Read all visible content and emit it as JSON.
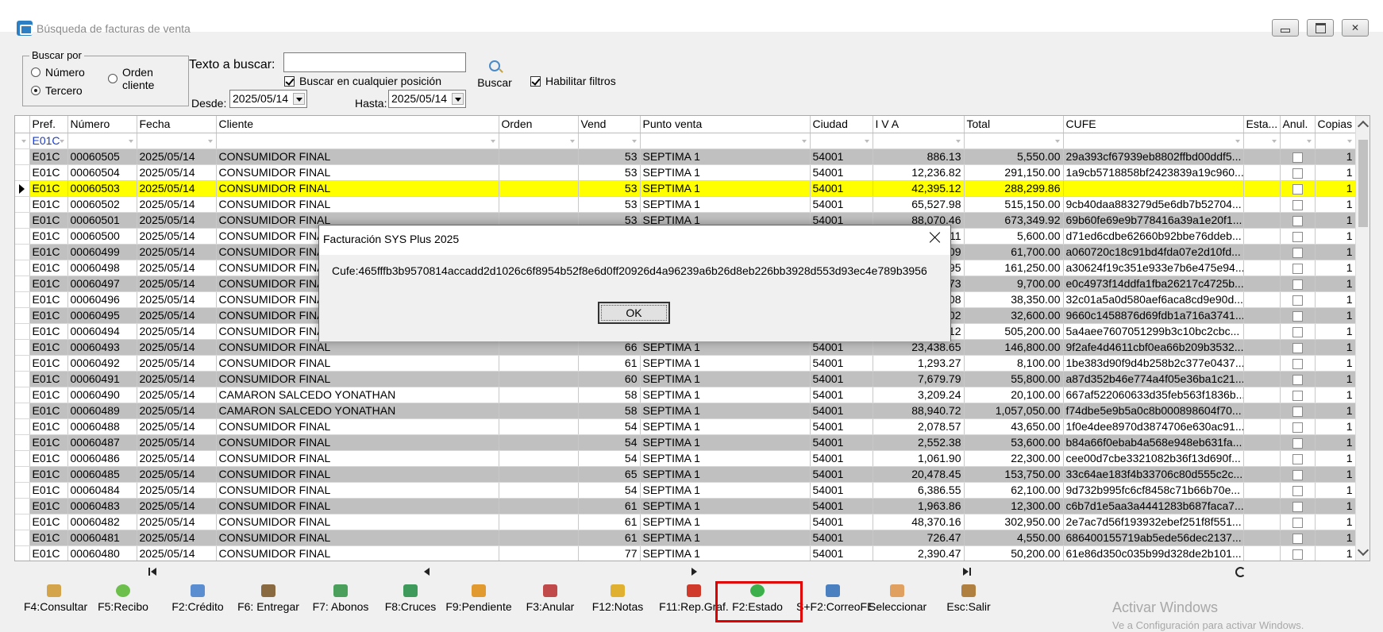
{
  "window": {
    "title": "Búsqueda de facturas de venta"
  },
  "search": {
    "group_label": "Buscar por",
    "radio_numero": "Número",
    "radio_orden": "Orden cliente",
    "radio_tercero": "Tercero",
    "selected": "Tercero",
    "text_label": "Texto a buscar:",
    "text_value": "",
    "any_position_label": "Buscar en cualquier posición",
    "any_position_checked": true,
    "filters_label": "Habilitar filtros",
    "filters_checked": true,
    "desde_label": "Desde:",
    "desde_value": "2025/05/14",
    "hasta_label": "Hasta:",
    "hasta_value": "2025/05/14",
    "buscar_label": "Buscar"
  },
  "grid": {
    "columns": [
      "Pref.",
      "Número",
      "Fecha",
      "Cliente",
      "Orden",
      "Vend",
      "Punto venta",
      "Ciudad",
      "I V A",
      "Total",
      "CUFE",
      "Esta...",
      "Anul.",
      "Copias"
    ],
    "filter_pref": "E01C",
    "selected_row_index": 2,
    "rows": [
      {
        "pref": "E01C",
        "numero": "00060505",
        "fecha": "2025/05/14",
        "cliente": "CONSUMIDOR FINAL",
        "orden": "",
        "vend": "53",
        "punto": "SEPTIMA 1",
        "ciudad": "54001",
        "iva": "886.13",
        "total": "5,550.00",
        "cufe": "29a393cf67939eb8802ffbd00ddf5...",
        "copias": "1"
      },
      {
        "pref": "E01C",
        "numero": "00060504",
        "fecha": "2025/05/14",
        "cliente": "CONSUMIDOR FINAL",
        "orden": "",
        "vend": "53",
        "punto": "SEPTIMA 1",
        "ciudad": "54001",
        "iva": "12,236.82",
        "total": "291,150.00",
        "cufe": "1a9cb5718858bf2423839a19c960...",
        "copias": "1"
      },
      {
        "pref": "E01C",
        "numero": "00060503",
        "fecha": "2025/05/14",
        "cliente": "CONSUMIDOR FINAL",
        "orden": "",
        "vend": "53",
        "punto": "SEPTIMA 1",
        "ciudad": "54001",
        "iva": "42,395.12",
        "total": "288,299.86",
        "cufe": "",
        "copias": "1"
      },
      {
        "pref": "E01C",
        "numero": "00060502",
        "fecha": "2025/05/14",
        "cliente": "CONSUMIDOR FINAL",
        "orden": "",
        "vend": "53",
        "punto": "SEPTIMA 1",
        "ciudad": "54001",
        "iva": "65,527.98",
        "total": "515,150.00",
        "cufe": "9cb40daa883279d5e6db7b52704...",
        "copias": "1"
      },
      {
        "pref": "E01C",
        "numero": "00060501",
        "fecha": "2025/05/14",
        "cliente": "CONSUMIDOR FINAL",
        "orden": "",
        "vend": "53",
        "punto": "SEPTIMA 1",
        "ciudad": "54001",
        "iva": "88,070.46",
        "total": "673,349.92",
        "cufe": "69b60fe69e9b778416a39a1e20f1...",
        "copias": "1"
      },
      {
        "pref": "E01C",
        "numero": "00060500",
        "fecha": "2025/05/14",
        "cliente": "CONSUMIDOR FINA",
        "orden": "",
        "vend": "",
        "punto": "",
        "ciudad": "",
        "iva": "11",
        "total": "5,600.00",
        "cufe": "d71ed6cdbe62660b92bbe76ddeb...",
        "copias": "1"
      },
      {
        "pref": "E01C",
        "numero": "00060499",
        "fecha": "2025/05/14",
        "cliente": "CONSUMIDOR FINA",
        "orden": "",
        "vend": "",
        "punto": "",
        "ciudad": "",
        "iva": "09",
        "total": "61,700.00",
        "cufe": "a060720c18c91bd4fda07e2d10fd...",
        "copias": "1"
      },
      {
        "pref": "E01C",
        "numero": "00060498",
        "fecha": "2025/05/14",
        "cliente": "CONSUMIDOR FINA",
        "orden": "",
        "vend": "",
        "punto": "",
        "ciudad": "",
        "iva": "95",
        "total": "161,250.00",
        "cufe": "a30624f19c351e933e7b6e475e94...",
        "copias": "1"
      },
      {
        "pref": "E01C",
        "numero": "00060497",
        "fecha": "2025/05/14",
        "cliente": "CONSUMIDOR FINA",
        "orden": "",
        "vend": "",
        "punto": "",
        "ciudad": "",
        "iva": "73",
        "total": "9,700.00",
        "cufe": "e0c4973f14ddfa1fba26217c4725b...",
        "copias": "1"
      },
      {
        "pref": "E01C",
        "numero": "00060496",
        "fecha": "2025/05/14",
        "cliente": "CONSUMIDOR FINA",
        "orden": "",
        "vend": "",
        "punto": "",
        "ciudad": "",
        "iva": "08",
        "total": "38,350.00",
        "cufe": "32c01a5a0d580aef6aca8cd9e90d...",
        "copias": "1"
      },
      {
        "pref": "E01C",
        "numero": "00060495",
        "fecha": "2025/05/14",
        "cliente": "CONSUMIDOR FINA",
        "orden": "",
        "vend": "",
        "punto": "",
        "ciudad": "",
        "iva": "02",
        "total": "32,600.00",
        "cufe": "9660c1458876d69fdb1a716a3741...",
        "copias": "1"
      },
      {
        "pref": "E01C",
        "numero": "00060494",
        "fecha": "2025/05/14",
        "cliente": "CONSUMIDOR FINA",
        "orden": "",
        "vend": "",
        "punto": "",
        "ciudad": "",
        "iva": "12",
        "total": "505,200.00",
        "cufe": "5a4aee7607051299b3c10bc2cbc...",
        "copias": "1"
      },
      {
        "pref": "E01C",
        "numero": "00060493",
        "fecha": "2025/05/14",
        "cliente": "CONSUMIDOR FINAL",
        "orden": "",
        "vend": "66",
        "punto": "SEPTIMA 1",
        "ciudad": "54001",
        "iva": "23,438.65",
        "total": "146,800.00",
        "cufe": "9f2afe4d4611cbf0ea66b209b3532...",
        "copias": "1"
      },
      {
        "pref": "E01C",
        "numero": "00060492",
        "fecha": "2025/05/14",
        "cliente": "CONSUMIDOR FINAL",
        "orden": "",
        "vend": "61",
        "punto": "SEPTIMA 1",
        "ciudad": "54001",
        "iva": "1,293.27",
        "total": "8,100.00",
        "cufe": "1be383d90f9d4b258b2c377e0437...",
        "copias": "1"
      },
      {
        "pref": "E01C",
        "numero": "00060491",
        "fecha": "2025/05/14",
        "cliente": "CONSUMIDOR FINAL",
        "orden": "",
        "vend": "60",
        "punto": "SEPTIMA 1",
        "ciudad": "54001",
        "iva": "7,679.79",
        "total": "55,800.00",
        "cufe": "a87d352b46e774a4f05e36ba1c21...",
        "copias": "1"
      },
      {
        "pref": "E01C",
        "numero": "00060490",
        "fecha": "2025/05/14",
        "cliente": "CAMARON SALCEDO YONATHAN",
        "orden": "",
        "vend": "58",
        "punto": "SEPTIMA 1",
        "ciudad": "54001",
        "iva": "3,209.24",
        "total": "20,100.00",
        "cufe": "667af522060633d35feb563f1836b...",
        "copias": "1"
      },
      {
        "pref": "E01C",
        "numero": "00060489",
        "fecha": "2025/05/14",
        "cliente": "CAMARON SALCEDO YONATHAN",
        "orden": "",
        "vend": "58",
        "punto": "SEPTIMA 1",
        "ciudad": "54001",
        "iva": "88,940.72",
        "total": "1,057,050.00",
        "cufe": "f74dbe5e9b5a0c8b000898604f70...",
        "copias": "1"
      },
      {
        "pref": "E01C",
        "numero": "00060488",
        "fecha": "2025/05/14",
        "cliente": "CONSUMIDOR FINAL",
        "orden": "",
        "vend": "54",
        "punto": "SEPTIMA 1",
        "ciudad": "54001",
        "iva": "2,078.57",
        "total": "43,650.00",
        "cufe": "1f0e4dee8970d3874706e630ac91...",
        "copias": "1"
      },
      {
        "pref": "E01C",
        "numero": "00060487",
        "fecha": "2025/05/14",
        "cliente": "CONSUMIDOR FINAL",
        "orden": "",
        "vend": "54",
        "punto": "SEPTIMA 1",
        "ciudad": "54001",
        "iva": "2,552.38",
        "total": "53,600.00",
        "cufe": "b84a66f0ebab4a568e948eb631fa...",
        "copias": "1"
      },
      {
        "pref": "E01C",
        "numero": "00060486",
        "fecha": "2025/05/14",
        "cliente": "CONSUMIDOR FINAL",
        "orden": "",
        "vend": "54",
        "punto": "SEPTIMA 1",
        "ciudad": "54001",
        "iva": "1,061.90",
        "total": "22,300.00",
        "cufe": "cee00d7cbe3321082b36f13d690f...",
        "copias": "1"
      },
      {
        "pref": "E01C",
        "numero": "00060485",
        "fecha": "2025/05/14",
        "cliente": "CONSUMIDOR FINAL",
        "orden": "",
        "vend": "65",
        "punto": "SEPTIMA 1",
        "ciudad": "54001",
        "iva": "20,478.45",
        "total": "153,750.00",
        "cufe": "33c64ae183f4b33706c80d555c2c...",
        "copias": "1"
      },
      {
        "pref": "E01C",
        "numero": "00060484",
        "fecha": "2025/05/14",
        "cliente": "CONSUMIDOR FINAL",
        "orden": "",
        "vend": "54",
        "punto": "SEPTIMA 1",
        "ciudad": "54001",
        "iva": "6,386.55",
        "total": "62,100.00",
        "cufe": "9d732b995fc6cf8458c71b66b70e...",
        "copias": "1"
      },
      {
        "pref": "E01C",
        "numero": "00060483",
        "fecha": "2025/05/14",
        "cliente": "CONSUMIDOR FINAL",
        "orden": "",
        "vend": "61",
        "punto": "SEPTIMA 1",
        "ciudad": "54001",
        "iva": "1,963.86",
        "total": "12,300.00",
        "cufe": "c6b7d1e5aa3a4441283b687faca7...",
        "copias": "1"
      },
      {
        "pref": "E01C",
        "numero": "00060482",
        "fecha": "2025/05/14",
        "cliente": "CONSUMIDOR FINAL",
        "orden": "",
        "vend": "61",
        "punto": "SEPTIMA 1",
        "ciudad": "54001",
        "iva": "48,370.16",
        "total": "302,950.00",
        "cufe": "2e7ac7d56f193932ebef251f8f551...",
        "copias": "1"
      },
      {
        "pref": "E01C",
        "numero": "00060481",
        "fecha": "2025/05/14",
        "cliente": "CONSUMIDOR FINAL",
        "orden": "",
        "vend": "61",
        "punto": "SEPTIMA 1",
        "ciudad": "54001",
        "iva": "726.47",
        "total": "4,550.00",
        "cufe": "686400155719ab5ede56dec2137...",
        "copias": "1"
      },
      {
        "pref": "E01C",
        "numero": "00060480",
        "fecha": "2025/05/14",
        "cliente": "CONSUMIDOR FINAL",
        "orden": "",
        "vend": "77",
        "punto": "SEPTIMA 1",
        "ciudad": "54001",
        "iva": "2,390.47",
        "total": "50,200.00",
        "cufe": "61e86d350c035b99d328de2b101...",
        "copias": "1"
      }
    ]
  },
  "toolbar": [
    {
      "name": "consultar-button",
      "label": "F4:Consultar",
      "icon": "document-search-icon",
      "color": "#d4a44a"
    },
    {
      "name": "recibo-button",
      "label": "F5:Recibo",
      "icon": "coin-icon",
      "color": "#6cbf4a"
    },
    {
      "name": "credito-button",
      "label": "F2:Crédito",
      "icon": "stack-icon",
      "color": "#5a8ed0"
    },
    {
      "name": "entregar-button",
      "label": "F6: Entregar",
      "icon": "truck-icon",
      "color": "#8a6a40"
    },
    {
      "name": "abonos-button",
      "label": "F7: Abonos",
      "icon": "money-icon",
      "color": "#4aa05a"
    },
    {
      "name": "cruces-button",
      "label": "F8:Cruces",
      "icon": "exchange-icon",
      "color": "#3d9a5a"
    },
    {
      "name": "pendiente-button",
      "label": "F9:Pendiente",
      "icon": "box-icon",
      "color": "#e09a30"
    },
    {
      "name": "anular-button",
      "label": "F3:Anular",
      "icon": "cancel-document-icon",
      "color": "#c04a4a"
    },
    {
      "name": "notas-button",
      "label": "F12:Notas",
      "icon": "note-icon",
      "color": "#e0b030"
    },
    {
      "name": "rep-graf-button",
      "label": "F11:Rep.Graf.",
      "icon": "pdf-icon",
      "color": "#d03a2a"
    },
    {
      "name": "estado-button",
      "label": "F2:Estado",
      "icon": "check-circle-icon",
      "color": "#3cb04a"
    },
    {
      "name": "correo-fe-button",
      "label": "S+F2:CorreoFE",
      "icon": "mail-icon",
      "color": "#4a7fc0"
    },
    {
      "name": "seleccionar-button",
      "label": "Seleccionar",
      "icon": "hand-icon",
      "color": "#e0a060"
    },
    {
      "name": "salir-button",
      "label": "Esc:Salir",
      "icon": "door-icon",
      "color": "#b08040"
    }
  ],
  "watermark": {
    "line1": "Activar Windows",
    "line2": "Ve a Configuración para activar Windows."
  },
  "dialog": {
    "title": "Facturación SYS Plus 2025",
    "message": "Cufe:465fffb3b9570814accadd2d1026c6f8954b52f8e6d0ff20926d4a96239a6b26d8eb226bb3928d553d93ec4e789b3956",
    "ok_label": "OK"
  }
}
